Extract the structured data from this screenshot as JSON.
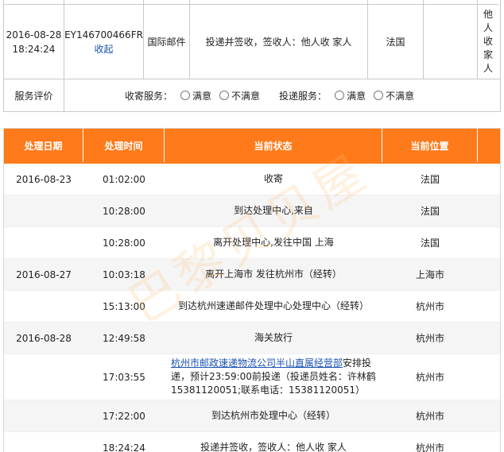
{
  "summary": {
    "datetime": "2016-08-28 18:24:24",
    "tracking_no": "EY146700466FR",
    "collapse_link": "收起",
    "service_type": "国际邮件",
    "status": "投递并签收，签收人：他人收 家人",
    "location": "法国",
    "extra": "",
    "signer": "他人收家人"
  },
  "rating": {
    "label": "服务评价",
    "pickup_label": "收寄服务：",
    "delivery_label": "投递服务：",
    "satisfied": "满意",
    "unsatisfied": "不满意"
  },
  "table": {
    "headers": [
      "处理日期",
      "处理时间",
      "当前状态",
      "当前位置"
    ],
    "rows": [
      {
        "date": "2016-08-23",
        "time": "01:02:00",
        "status": "收寄",
        "location": "法国"
      },
      {
        "date": "",
        "time": "10:28:00",
        "status": "到达处理中心,来自",
        "location": "法国"
      },
      {
        "date": "",
        "time": "10:28:00",
        "status": "离开处理中心,发往中国 上海",
        "location": "法国"
      },
      {
        "date": "2016-08-27",
        "time": "10:03:18",
        "status": "离开上海市 发往杭州市（经转）",
        "location": "上海市"
      },
      {
        "date": "",
        "time": "15:13:00",
        "status": "到达杭州速递邮件处理中心处理中心（经转）",
        "location": "杭州市"
      },
      {
        "date": "2016-08-28",
        "time": "12:49:58",
        "status": "海关放行",
        "location": "杭州市"
      },
      {
        "date": "",
        "time": "17:03:55",
        "status_link": "杭州市邮政速递物流公司半山直属经营部",
        "status": "安排投递，预计23:59:00前投递（投递员姓名：许林鹤15381120051;联系电话：15381120051）",
        "location": "杭州市"
      },
      {
        "date": "",
        "time": "17:22:00",
        "status": "到达杭州市处理中心（经转）",
        "location": "杭州市"
      },
      {
        "date": "",
        "time": "18:24:24",
        "status": "投递并签收，签收人：他人收 家人",
        "location": "杭州市"
      }
    ]
  },
  "watermark": "巴黎贝贝屋",
  "colors": {
    "header_bg": "#ff7a1a",
    "link": "#1a52b3"
  }
}
